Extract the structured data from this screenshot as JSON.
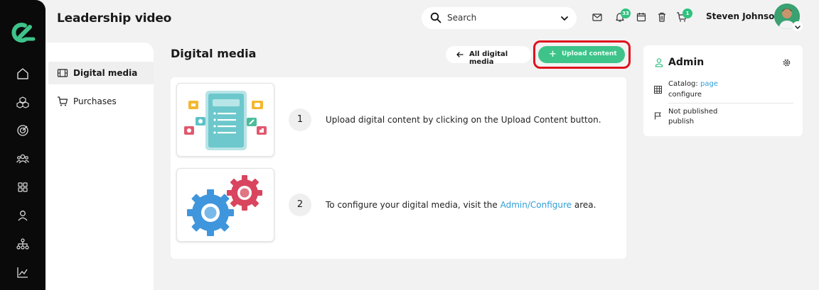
{
  "header": {
    "title": "Leadership video",
    "search_placeholder": "Search",
    "notifications_count": "33",
    "cart_count": "1",
    "user_name": "Steven Johnson"
  },
  "rail": {
    "icons": [
      "home-icon",
      "modules-icon",
      "target-icon",
      "people-icon",
      "apps-icon",
      "profile-icon",
      "org-chart-icon",
      "analytics-icon"
    ]
  },
  "subnav": {
    "items": [
      {
        "label": "Digital media",
        "icon": "film-icon",
        "active": true
      },
      {
        "label": "Purchases",
        "icon": "cart-icon",
        "active": false
      }
    ]
  },
  "page": {
    "title": "Digital media",
    "back_label": "All digital media",
    "upload_plus": "+",
    "upload_label": "Upload content"
  },
  "steps": [
    {
      "number": "1",
      "text": "Upload digital content by clicking on the Upload Content button."
    },
    {
      "number": "2",
      "text_before": "To configure your digital media, visit the ",
      "link": "Admin/Configure",
      "text_after": " area."
    }
  ],
  "admin": {
    "title": "Admin",
    "catalog_label": "Catalog:",
    "catalog_link": "page",
    "configure_link": "configure",
    "status": "Not published",
    "publish_link": "publish"
  },
  "colors": {
    "accent_green": "#3ec38a",
    "highlight_red": "#e0121e",
    "link_blue": "#2f9fd8",
    "rail_bg": "#0a0a0a"
  }
}
